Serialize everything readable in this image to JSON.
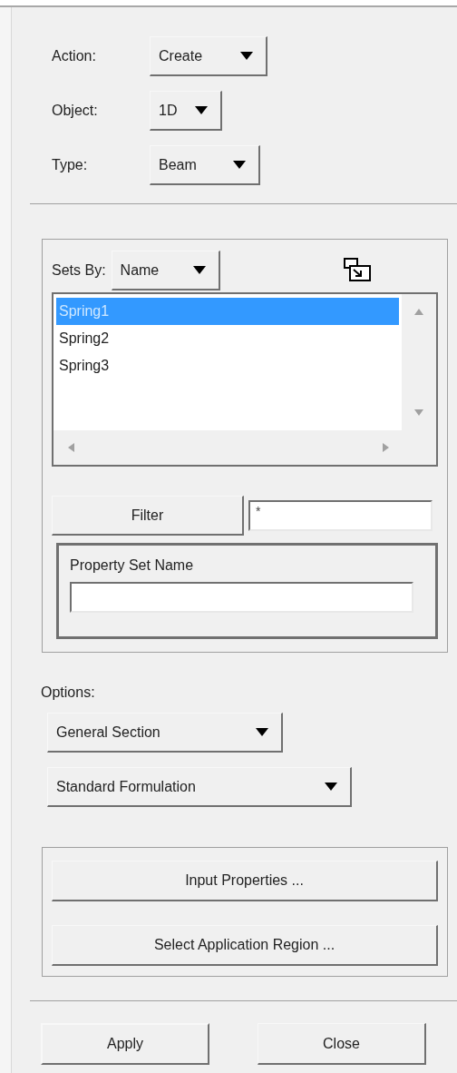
{
  "fields": [
    {
      "label": "Action:",
      "value": "Create"
    },
    {
      "label": "Object:",
      "value": "1D"
    },
    {
      "label": "Type:",
      "value": "Beam"
    }
  ],
  "sets": {
    "label": "Sets By:",
    "value": "Name",
    "items": [
      {
        "name": "Spring1",
        "selected": true
      },
      {
        "name": "Spring2",
        "selected": false
      },
      {
        "name": "Spring3",
        "selected": false
      }
    ],
    "filter_button": "Filter",
    "filter_value": "*",
    "property_set_label": "Property Set Name"
  },
  "options": {
    "label": "Options:",
    "dropdowns": [
      "General Section",
      "Standard Formulation"
    ]
  },
  "action_buttons": [
    "Input Properties ...",
    "Select Application Region ..."
  ],
  "footer_buttons": [
    "Apply",
    "Close"
  ]
}
